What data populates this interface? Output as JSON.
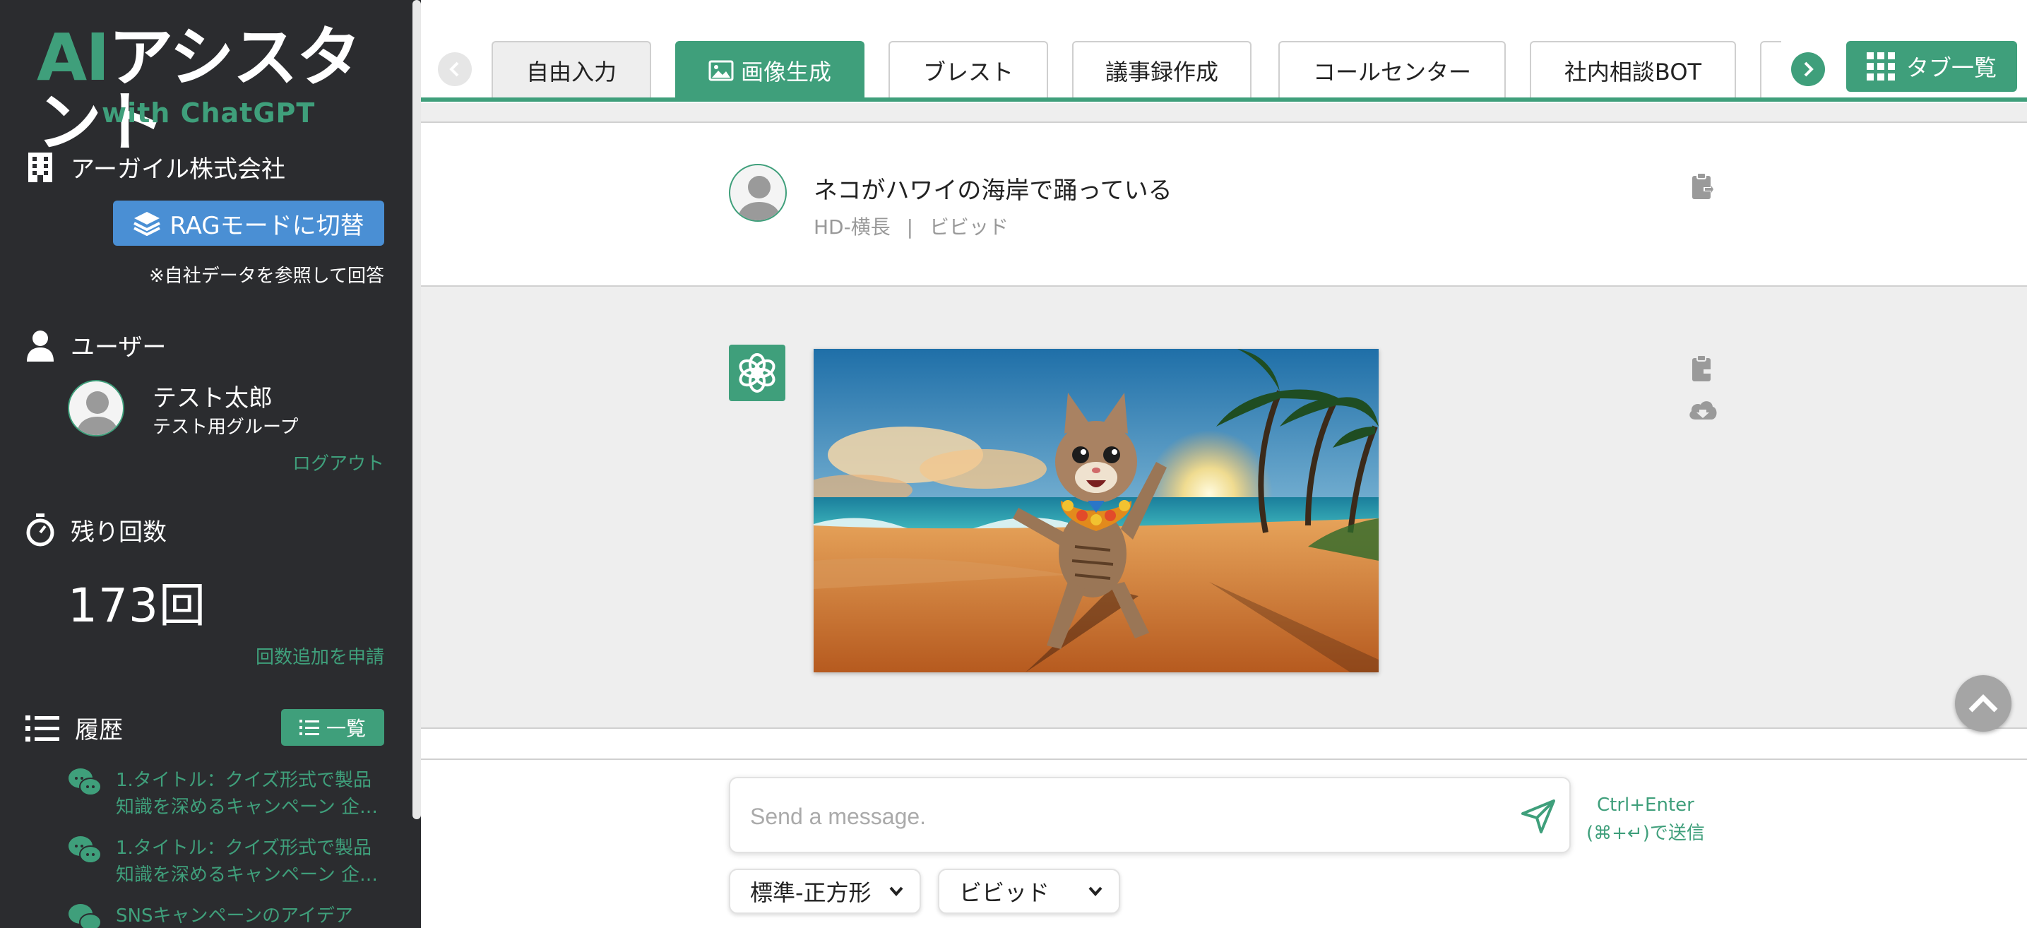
{
  "app": {
    "logo_ai": "AI",
    "logo_main": "アシスタント",
    "logo_sub": "with ChatGPT"
  },
  "sidebar": {
    "company": "アーガイル株式会社",
    "rag_button": "RAGモードに切替",
    "rag_note": "※自社データを参照して回答",
    "user_section": "ユーザー",
    "user_name": "テスト太郎",
    "user_group": "テスト用グループ",
    "logout": "ログアウト",
    "remain_section": "残り回数",
    "remain_count": "173回",
    "add_count": "回数追加を申請",
    "history_section": "履歴",
    "history_button": "一覧",
    "history": [
      {
        "line1": "1.タイトル：クイズ形式で製品",
        "line2": "知識を深めるキャンペーン 企…"
      },
      {
        "line1": "1.タイトル：クイズ形式で製品",
        "line2": "知識を深めるキャンペーン 企…"
      },
      {
        "line1": "SNSキャンペーンのアイデア",
        "line2": ""
      }
    ]
  },
  "tabs": [
    {
      "label": "自由入力",
      "state": "normal"
    },
    {
      "label": "画像生成",
      "state": "active"
    },
    {
      "label": "ブレスト",
      "state": "normal"
    },
    {
      "label": "議事録作成",
      "state": "normal"
    },
    {
      "label": "コールセンター",
      "state": "normal"
    },
    {
      "label": "社内相談BOT",
      "state": "normal"
    }
  ],
  "tab_list_button": "タブ一覧",
  "conversation": {
    "user_message": "ネコがハワイの海岸で踊っている",
    "user_meta_size": "HD-横長",
    "user_meta_sep": "|",
    "user_meta_style": "ビビッド"
  },
  "composer": {
    "placeholder": "Send a message.",
    "hint_line1": "Ctrl+Enter",
    "hint_line2": "(⌘+↵)で送信",
    "size_select": "標準-正方形",
    "style_select": "ビビッド"
  },
  "colors": {
    "accent": "#3f9f7b",
    "sidebar_bg": "#2b2c2f",
    "rag_blue": "#4a8fd4"
  }
}
